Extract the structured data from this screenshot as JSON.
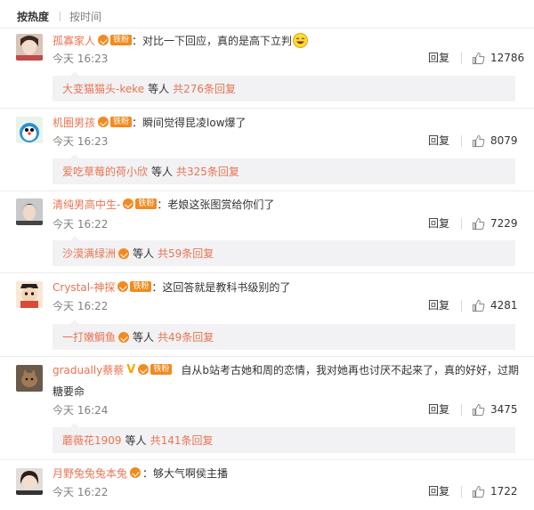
{
  "tabs": [
    {
      "label": "按热度"
    },
    {
      "label": "按时间"
    }
  ],
  "reply_label": "回复",
  "etc_label": "等人",
  "fan_badge": "铁粉",
  "comments": [
    {
      "user": "孤寡家人",
      "colon": "：",
      "text": "对比一下回应，真的是高下立判",
      "time": "今天 16:23",
      "likes": "12786",
      "reply_user": "大变猫猫头-keke",
      "reply_count": "共276条回复"
    },
    {
      "user": "机圈男孩",
      "colon": "：",
      "text": "瞬间觉得昆凌low爆了",
      "time": "今天 16:23",
      "likes": "8079",
      "reply_user": "爱吃草莓的荷小欣",
      "reply_count": "共325条回复"
    },
    {
      "user": "清纯男高中生-",
      "colon": "：",
      "text": "老娘这张图赏给你们了",
      "time": "今天 16:22",
      "likes": "7229",
      "reply_user": "沙漠满绿洲",
      "reply_count": "共59条回复"
    },
    {
      "user": "Crystal-神探",
      "colon": "：",
      "text": "这回答就是教科书级别的了",
      "time": "今天 16:22",
      "likes": "4281",
      "reply_user": "一打嫩鲷鱼",
      "reply_count": "共49条回复"
    },
    {
      "user": "gradually蔡蔡",
      "colon": "：",
      "text": "自从b站考古她和周的恋情，我对她再也讨厌不起来了，真的好好，过期",
      "text2": "糖要命",
      "time": "今天 16:24",
      "likes": "3475",
      "reply_user": "蘑薇花1909",
      "reply_count": "共141条回复"
    },
    {
      "user": "月野兔兔兔本兔",
      "colon": "：",
      "text": "够大气啊侯主播",
      "time": "今天 16:22",
      "likes": "1722"
    }
  ]
}
